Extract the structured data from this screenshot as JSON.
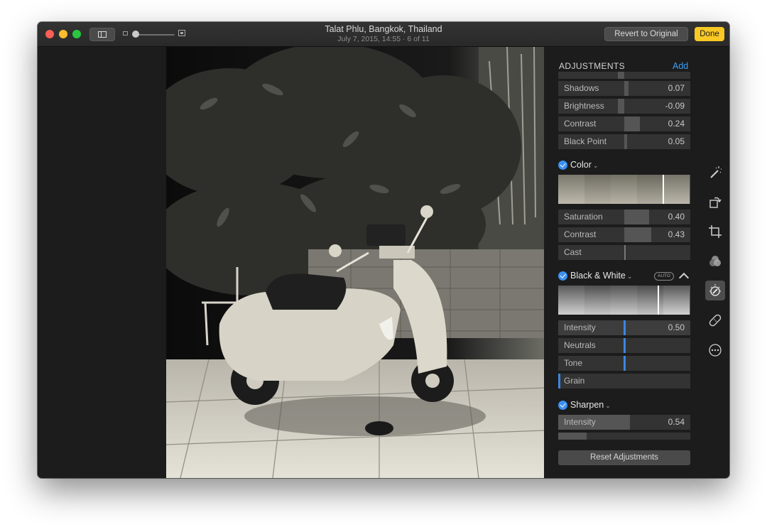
{
  "window": {
    "title": "Talat Phlu, Bangkok, Thailand",
    "subtitle": "July 7, 2015, 14:55 · 6 of 11",
    "revert_label": "Revert to Original",
    "done_label": "Done"
  },
  "panel": {
    "title": "ADJUSTMENTS",
    "add_label": "Add",
    "light_sliders": [
      {
        "label": "Shadows",
        "value": "0.07",
        "level": 0.07
      },
      {
        "label": "Brightness",
        "value": "-0.09",
        "level": -0.09
      },
      {
        "label": "Contrast",
        "value": "0.24",
        "level": 0.24
      },
      {
        "label": "Black Point",
        "value": "0.05",
        "level": 0.05
      }
    ],
    "color": {
      "label": "Color",
      "sliders": [
        {
          "label": "Saturation",
          "value": "0.40",
          "level": 0.4
        },
        {
          "label": "Contrast",
          "value": "0.43",
          "level": 0.43
        },
        {
          "label": "Cast",
          "value": "",
          "level": 0
        }
      ]
    },
    "bw": {
      "label": "Black & White",
      "auto_label": "AUTO",
      "sliders": [
        {
          "label": "Intensity",
          "value": "0.50",
          "level": 0.5
        },
        {
          "label": "Neutrals",
          "value": "",
          "level": 0
        },
        {
          "label": "Tone",
          "value": "",
          "level": 0
        },
        {
          "label": "Grain",
          "value": "",
          "level": 0
        }
      ]
    },
    "sharpen": {
      "label": "Sharpen",
      "sliders": [
        {
          "label": "Intensity",
          "value": "0.54",
          "level": 0.54
        }
      ]
    },
    "reset_label": "Reset Adjustments"
  },
  "colors": {
    "accent_blue": "#3b8ff0",
    "done_yellow": "#f9c825",
    "background": "#1c1c1c"
  },
  "tools": [
    "magic-wand-icon",
    "rotate-icon",
    "crop-icon",
    "filters-icon",
    "adjust-icon",
    "retouch-icon",
    "more-icon"
  ]
}
